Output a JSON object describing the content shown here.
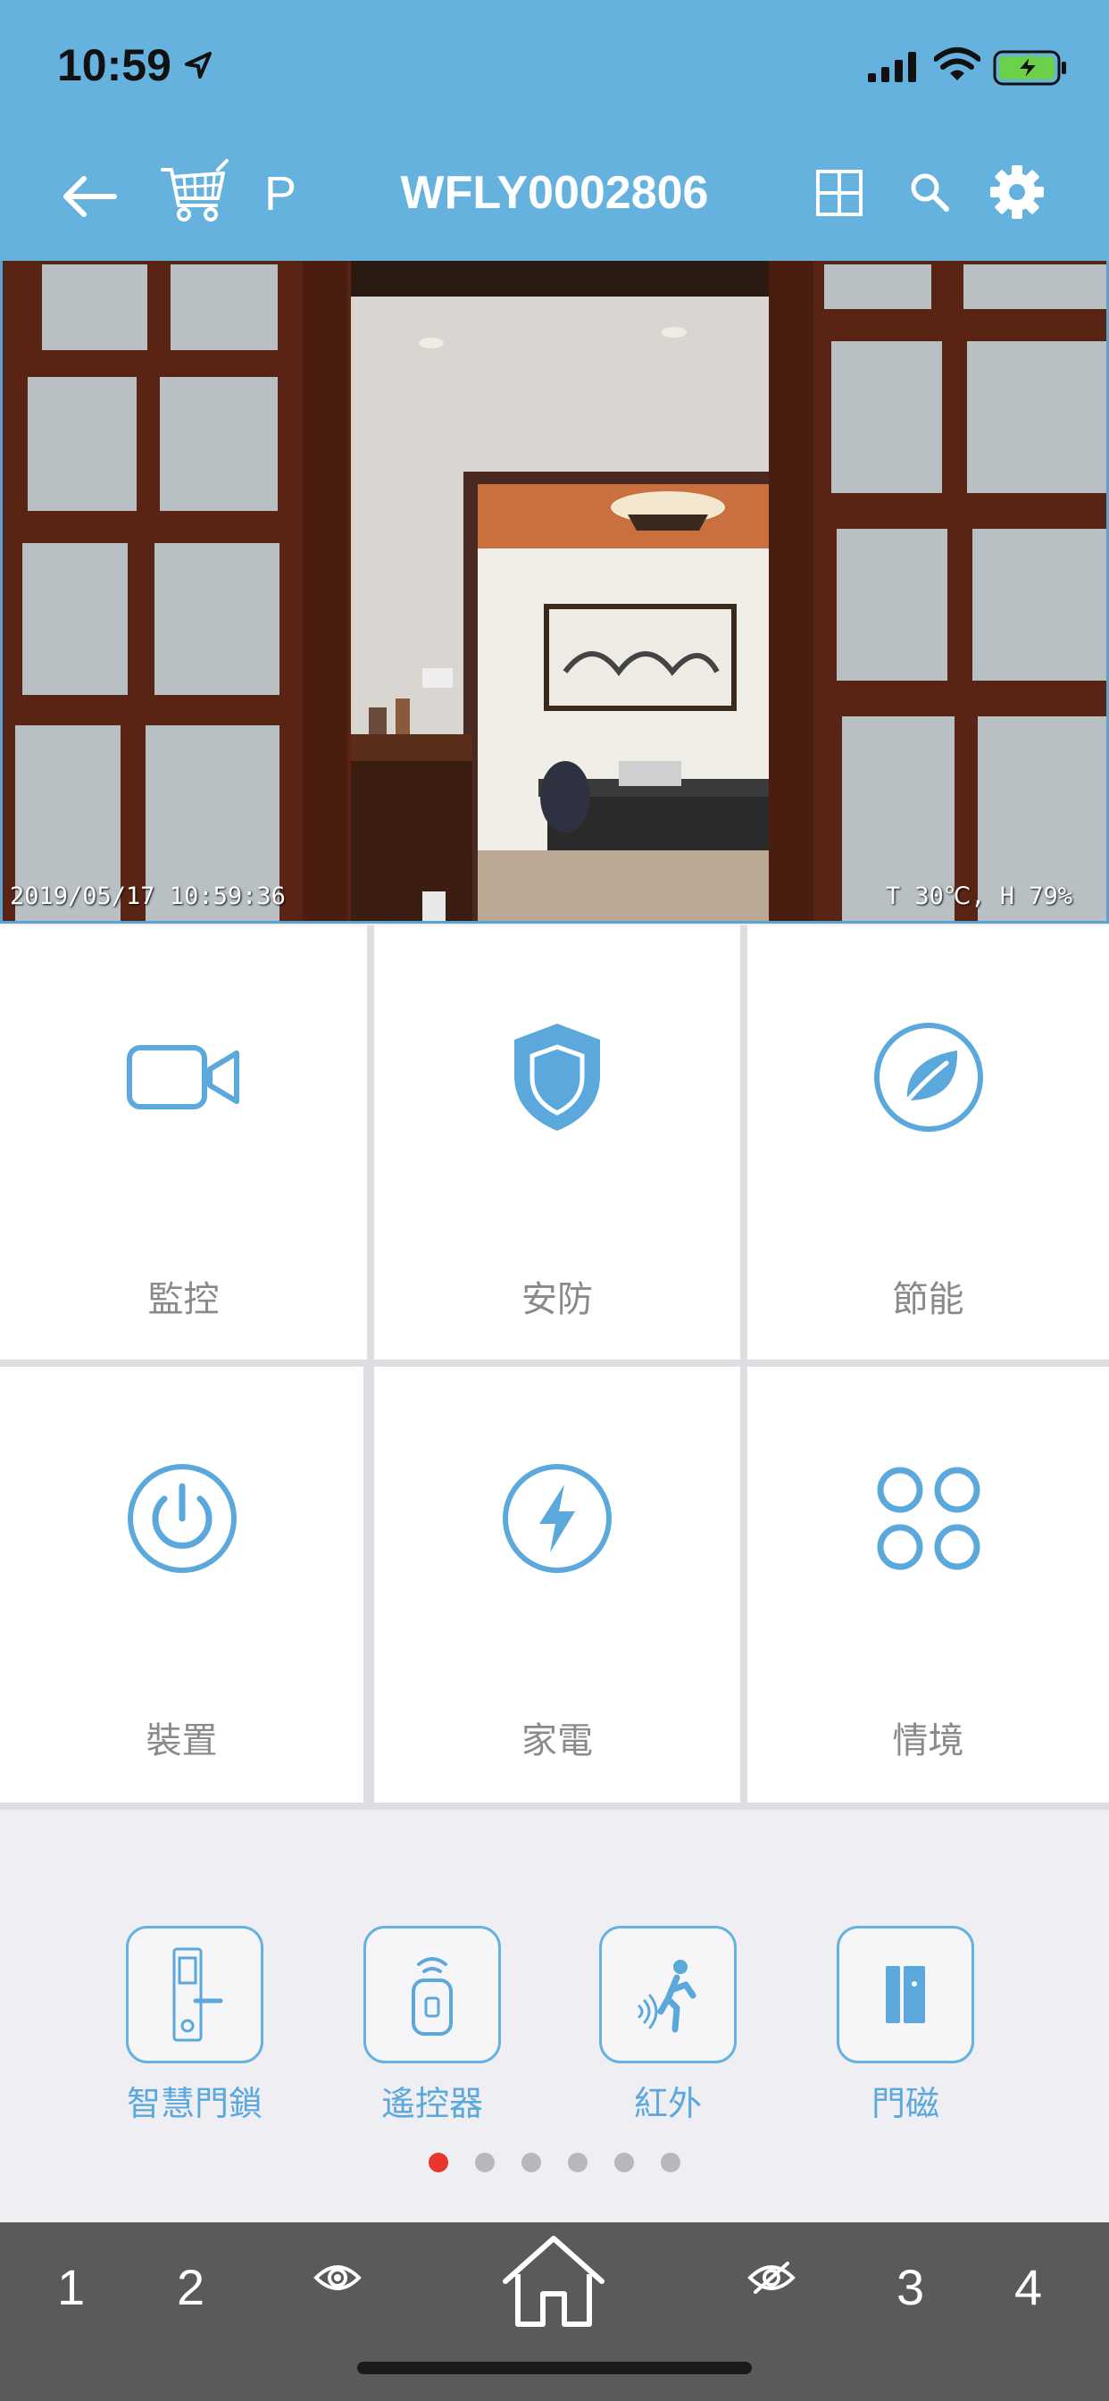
{
  "status_bar": {
    "time": "10:59"
  },
  "nav": {
    "title": "WFLY0002806",
    "p_label": "P"
  },
  "camera": {
    "timestamp": "2019/05/17 10:59:36",
    "readout": "T 30℃, H 79%"
  },
  "menu": [
    {
      "label": "監控",
      "icon": "video-camera-icon"
    },
    {
      "label": "安防",
      "icon": "shield-icon"
    },
    {
      "label": "節能",
      "icon": "leaf-icon"
    },
    {
      "label": "裝置",
      "icon": "power-icon"
    },
    {
      "label": "家電",
      "icon": "lightning-icon"
    },
    {
      "label": "情境",
      "icon": "four-circles-icon"
    }
  ],
  "quick_devices": [
    {
      "label": "智慧門鎖",
      "icon": "door-lock-icon"
    },
    {
      "label": "遙控器",
      "icon": "remote-control-icon"
    },
    {
      "label": "紅外",
      "icon": "motion-sensor-icon"
    },
    {
      "label": "門磁",
      "icon": "door-sensor-icon"
    }
  ],
  "pager": {
    "count": 6,
    "active": 0
  },
  "tabbar": {
    "tab1": "1",
    "tab2": "2",
    "tab3": "3",
    "tab4": "4"
  },
  "colors": {
    "header_blue": "#66b2df",
    "icon_blue": "#5aa8dc",
    "tabbar_gray": "#5a5a5a",
    "active_dot": "#e8352e"
  }
}
